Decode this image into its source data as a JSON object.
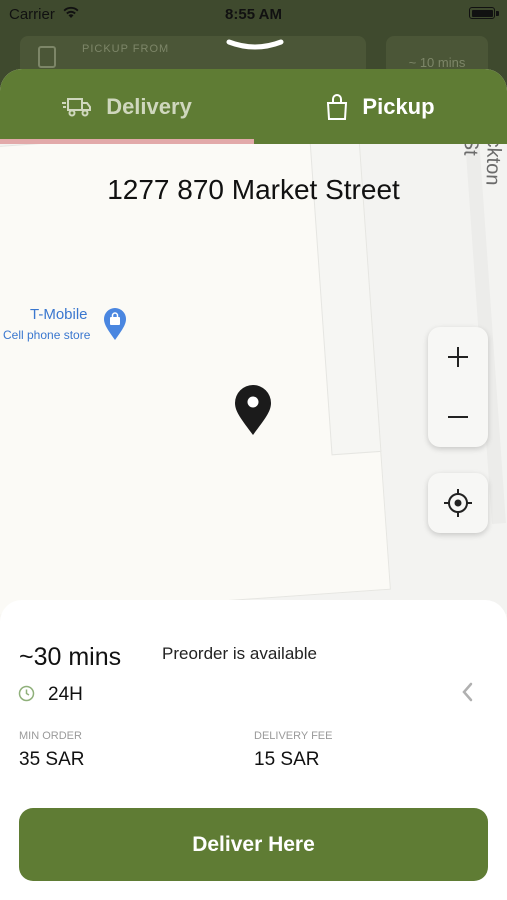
{
  "status_bar": {
    "carrier": "Carrier",
    "time": "8:55 AM"
  },
  "background_header": {
    "pickup_from_label": "PICKUP FROM",
    "time_estimate": "~ 10 mins"
  },
  "tabs": [
    {
      "label": "Delivery",
      "icon": "delivery-truck-icon",
      "selected": true
    },
    {
      "label": "Pickup",
      "icon": "shopping-bag-icon",
      "selected": false
    }
  ],
  "map": {
    "address": "1277 870 Market Street",
    "street_label": "ckton St",
    "poi": {
      "name": "T-Mobile",
      "category": "Cell phone store"
    }
  },
  "panel": {
    "eta": "~30 mins",
    "preorder": "Preorder is available",
    "hours": "24H",
    "min_order_label": "MIN ORDER",
    "min_order_value": "35 SAR",
    "delivery_fee_label": "DELIVERY FEE",
    "delivery_fee_value": "15 SAR",
    "action_button": "Deliver Here"
  },
  "colors": {
    "brand_green": "#5f7c34",
    "tab_indicator": "#e2a9a9",
    "map_link_blue": "#3a77cf"
  }
}
